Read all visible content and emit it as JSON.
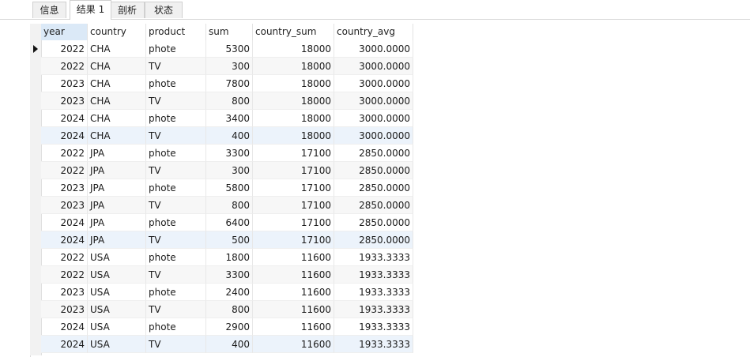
{
  "tabs": [
    {
      "label": "信息",
      "active": false
    },
    {
      "label": "结果 1",
      "active": true
    },
    {
      "label": "剖析",
      "active": false
    },
    {
      "label": "状态",
      "active": false
    }
  ],
  "columns": [
    "year",
    "country",
    "product",
    "sum",
    "country_sum",
    "country_avg"
  ],
  "rows": [
    [
      "2022",
      "CHA",
      "phote",
      "5300",
      "18000",
      "3000.0000"
    ],
    [
      "2022",
      "CHA",
      "TV",
      "300",
      "18000",
      "3000.0000"
    ],
    [
      "2023",
      "CHA",
      "phote",
      "7800",
      "18000",
      "3000.0000"
    ],
    [
      "2023",
      "CHA",
      "TV",
      "800",
      "18000",
      "3000.0000"
    ],
    [
      "2024",
      "CHA",
      "phote",
      "3400",
      "18000",
      "3000.0000"
    ],
    [
      "2024",
      "CHA",
      "TV",
      "400",
      "18000",
      "3000.0000"
    ],
    [
      "2022",
      "JPA",
      "phote",
      "3300",
      "17100",
      "2850.0000"
    ],
    [
      "2022",
      "JPA",
      "TV",
      "300",
      "17100",
      "2850.0000"
    ],
    [
      "2023",
      "JPA",
      "phote",
      "5800",
      "17100",
      "2850.0000"
    ],
    [
      "2023",
      "JPA",
      "TV",
      "800",
      "17100",
      "2850.0000"
    ],
    [
      "2024",
      "JPA",
      "phote",
      "6400",
      "17100",
      "2850.0000"
    ],
    [
      "2024",
      "JPA",
      "TV",
      "500",
      "17100",
      "2850.0000"
    ],
    [
      "2022",
      "USA",
      "phote",
      "1800",
      "11600",
      "1933.3333"
    ],
    [
      "2022",
      "USA",
      "TV",
      "3300",
      "11600",
      "1933.3333"
    ],
    [
      "2023",
      "USA",
      "phote",
      "2400",
      "11600",
      "1933.3333"
    ],
    [
      "2023",
      "USA",
      "TV",
      "800",
      "11600",
      "1933.3333"
    ],
    [
      "2024",
      "USA",
      "phote",
      "2900",
      "11600",
      "1933.3333"
    ],
    [
      "2024",
      "USA",
      "TV",
      "400",
      "11600",
      "1933.3333"
    ]
  ],
  "current_row_index": 0,
  "selected_column": "year",
  "colors": {
    "header_selected": "#dbe9f7",
    "row_alt": "#f7f7f7",
    "row_highlight": "#ecf3fb"
  }
}
